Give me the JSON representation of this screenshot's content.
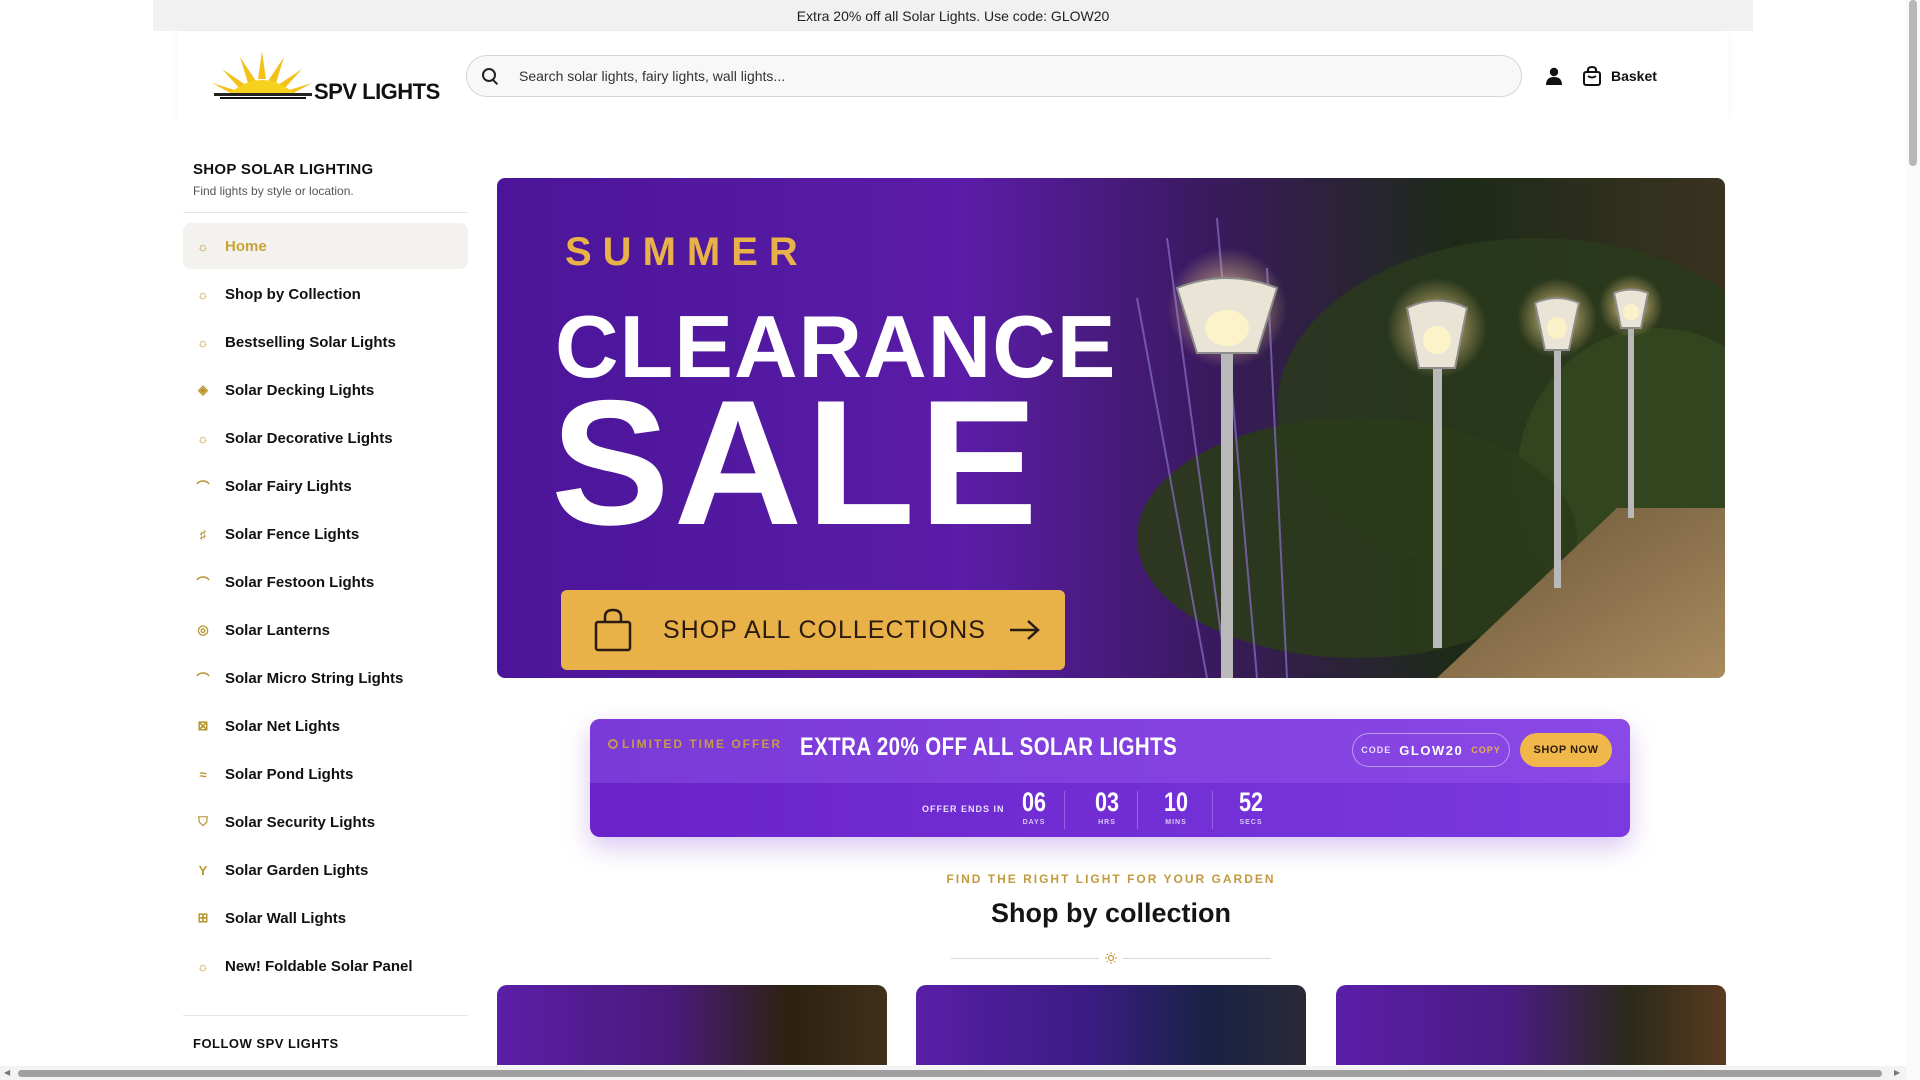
{
  "announcement": "Extra 20% off all Solar Lights. Use code: GLOW20",
  "header": {
    "logo_text": "SPV LIGHTS",
    "search_placeholder": "Search solar lights, fairy lights, wall lights...",
    "basket_label": "Basket"
  },
  "sidebar": {
    "title": "SHOP SOLAR LIGHTING",
    "subtitle": "Find lights by style or location.",
    "items": [
      {
        "label": "Home",
        "icon": "sun-icon"
      },
      {
        "label": "Shop by Collection",
        "icon": "sun-icon"
      },
      {
        "label": "Bestselling Solar Lights",
        "icon": "sun-icon"
      },
      {
        "label": "Solar Decking Lights",
        "icon": "layers-icon"
      },
      {
        "label": "Solar Decorative Lights",
        "icon": "sun-icon"
      },
      {
        "label": "Solar Fairy Lights",
        "icon": "arc-icon"
      },
      {
        "label": "Solar Fence Lights",
        "icon": "fence-icon"
      },
      {
        "label": "Solar Festoon Lights",
        "icon": "festoon-icon"
      },
      {
        "label": "Solar Lanterns",
        "icon": "lantern-icon"
      },
      {
        "label": "Solar Micro String Lights",
        "icon": "arc-icon"
      },
      {
        "label": "Solar Net Lights",
        "icon": "net-icon"
      },
      {
        "label": "Solar Pond Lights",
        "icon": "wave-icon"
      },
      {
        "label": "Solar Security Lights",
        "icon": "shield-icon"
      },
      {
        "label": "Solar Garden Lights",
        "icon": "sprout-icon"
      },
      {
        "label": "Solar Wall Lights",
        "icon": "grid-icon"
      },
      {
        "label": "New! Foldable Solar Panel",
        "icon": "sun-icon"
      }
    ],
    "follow_label": "FOLLOW SPV LIGHTS"
  },
  "hero": {
    "kicker": "SUMMER",
    "title_line1": "CLEARANCE",
    "title_line2": "SALE",
    "button_label": "SHOP ALL COLLECTIONS"
  },
  "offer": {
    "tag": "LIMITED TIME OFFER",
    "title": "EXTRA 20% OFF ALL SOLAR LIGHTS",
    "code_label": "CODE",
    "code_value": "GLOW20",
    "copy_label": "COPY",
    "shop_label": "SHOP NOW",
    "ends_label": "OFFER ENDS IN",
    "countdown": [
      {
        "value": "06",
        "unit": "DAYS"
      },
      {
        "value": "03",
        "unit": "HRS"
      },
      {
        "value": "10",
        "unit": "MINS"
      },
      {
        "value": "52",
        "unit": "SECS"
      }
    ]
  },
  "collections": {
    "kicker": "FIND THE RIGHT LIGHT FOR YOUR GARDEN",
    "title": "Shop by collection"
  },
  "colors": {
    "accent_gold": "#e8b249",
    "brand_purple": "#5b1ca8",
    "offer_purple": "#7a3ad7"
  }
}
